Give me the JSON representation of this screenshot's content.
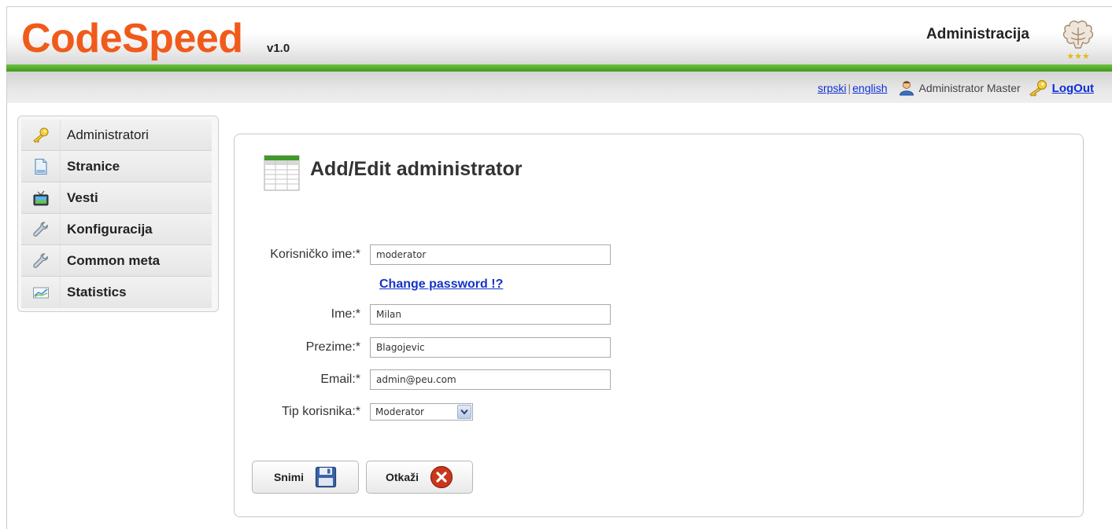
{
  "header": {
    "logo": "CodeSpeed",
    "version": "v1.0",
    "section_title": "Administracija"
  },
  "topbar": {
    "lang_sr": "srpski",
    "separator": "|",
    "lang_en": "english",
    "user_name": "Administrator Master",
    "logout": "LogOut"
  },
  "sidebar": {
    "items": [
      {
        "label": "Administratori",
        "icon": "key-icon"
      },
      {
        "label": "Stranice",
        "icon": "page-icon"
      },
      {
        "label": "Vesti",
        "icon": "tv-icon"
      },
      {
        "label": "Konfiguracija",
        "icon": "wrench-icon"
      },
      {
        "label": "Common meta",
        "icon": "wrench-icon"
      },
      {
        "label": "Statistics",
        "icon": "chart-icon"
      }
    ]
  },
  "form": {
    "title": "Add/Edit administrator",
    "username_label": "Korisničko ime:*",
    "username_value": "moderator",
    "change_password": "Change password !?",
    "first_name_label": "Ime:*",
    "first_name_value": "Milan",
    "last_name_label": "Prezime:*",
    "last_name_value": "Blagojevic",
    "email_label": "Email:*",
    "email_value": "admin@peu.com",
    "user_type_label": "Tip korisnika:*",
    "user_type_value": "Moderator",
    "save_label": "Snimi",
    "cancel_label": "Otkaži"
  },
  "colors": {
    "brand_orange": "#f05a1a",
    "green_bar": "#4fa82a",
    "link_blue": "#1432c8",
    "cancel_red": "#c9361c"
  }
}
